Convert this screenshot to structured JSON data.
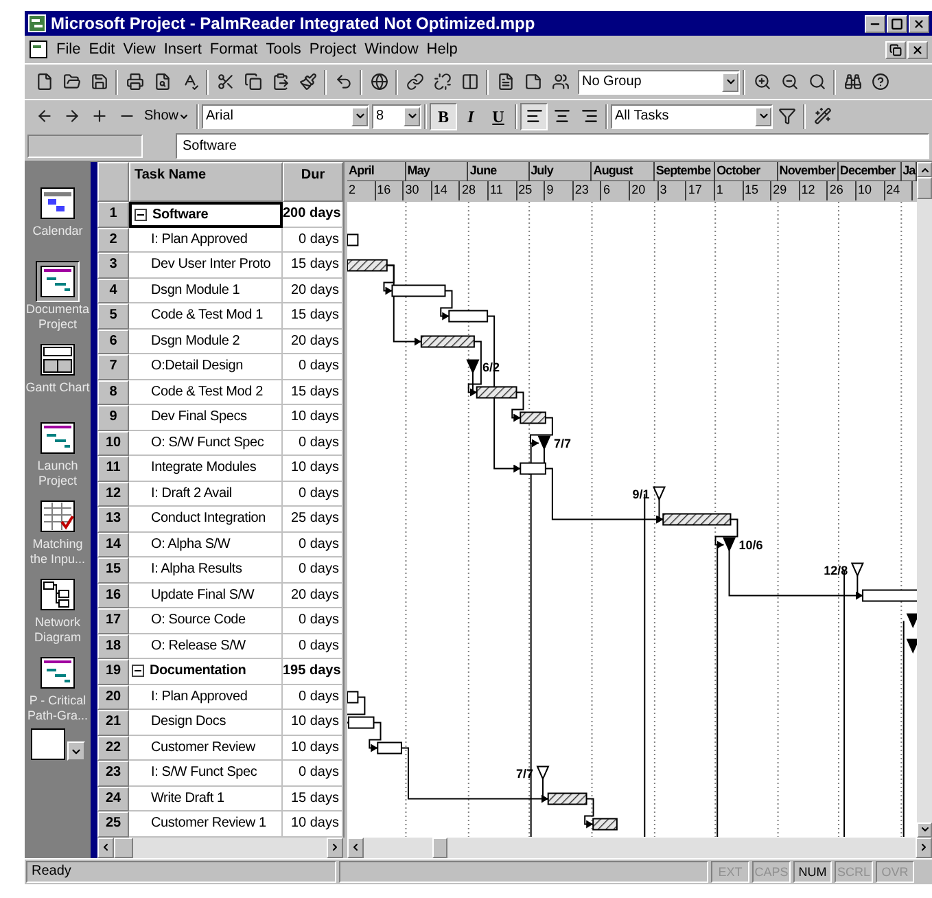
{
  "window": {
    "title": "Microsoft Project - PalmReader Integrated Not Optimized.mpp"
  },
  "menu": [
    "File",
    "Edit",
    "View",
    "Insert",
    "Format",
    "Tools",
    "Project",
    "Window",
    "Help"
  ],
  "standard_toolbar": {
    "group": "No Group"
  },
  "formatting_toolbar": {
    "show": "Show",
    "font": "Arial",
    "size": "8",
    "styles": [
      {
        "label": "B",
        "on": true
      },
      {
        "label": "I",
        "on": false
      },
      {
        "label": "U",
        "on": false
      }
    ],
    "align_buttons": [
      {
        "selected": true
      },
      {
        "selected": false
      },
      {
        "selected": false
      }
    ],
    "filter": "All Tasks"
  },
  "entry_bar": {
    "value": "Software"
  },
  "view_bar": {
    "items": [
      {
        "label": "Calendar",
        "selected": false
      },
      {
        "label": "Documenta Project",
        "selected": true
      },
      {
        "label": "Gantt Chart",
        "selected": false
      },
      {
        "label": "Launch Project",
        "selected": false
      },
      {
        "label": "Matching the Inpu...",
        "selected": false
      },
      {
        "label": "Network Diagram",
        "selected": false
      },
      {
        "label": "P - Critical Path-Gra...",
        "selected": false
      }
    ]
  },
  "table": {
    "columns": [
      "Task Name",
      "Dur"
    ],
    "rows": [
      {
        "id": "1",
        "name": "Software",
        "duration": "200 days",
        "kind": "summary",
        "expanded": true,
        "selected": true
      },
      {
        "id": "2",
        "name": "I: Plan Approved",
        "duration": "0 days",
        "kind": "task",
        "selected": false
      },
      {
        "id": "3",
        "name": "Dev User Inter Proto",
        "duration": "15 days",
        "kind": "task",
        "selected": false
      },
      {
        "id": "4",
        "name": "Dsgn Module 1",
        "duration": "20 days",
        "kind": "task",
        "selected": false
      },
      {
        "id": "5",
        "name": "Code & Test Mod 1",
        "duration": "15 days",
        "kind": "task",
        "selected": false
      },
      {
        "id": "6",
        "name": "Dsgn Module 2",
        "duration": "20 days",
        "kind": "task",
        "selected": false
      },
      {
        "id": "7",
        "name": "O:Detail Design",
        "duration": "0 days",
        "kind": "task",
        "selected": false,
        "gantt_label": "6/2"
      },
      {
        "id": "8",
        "name": "Code & Test Mod 2",
        "duration": "15 days",
        "kind": "task",
        "selected": false
      },
      {
        "id": "9",
        "name": "Dev Final Specs",
        "duration": "10 days",
        "kind": "task",
        "selected": false
      },
      {
        "id": "10",
        "name": "O: S/W Funct Spec",
        "duration": "0 days",
        "kind": "task",
        "selected": false,
        "gantt_label": "7/7"
      },
      {
        "id": "11",
        "name": "Integrate Modules",
        "duration": "10 days",
        "kind": "task",
        "selected": false
      },
      {
        "id": "12",
        "name": "I: Draft 2 Avail",
        "duration": "0 days",
        "kind": "task",
        "selected": false,
        "gantt_label": "9/1"
      },
      {
        "id": "13",
        "name": "Conduct Integration",
        "duration": "25 days",
        "kind": "task",
        "selected": false
      },
      {
        "id": "14",
        "name": "O: Alpha S/W",
        "duration": "0 days",
        "kind": "task",
        "selected": false,
        "gantt_label": "10/6"
      },
      {
        "id": "15",
        "name": "I: Alpha Results",
        "duration": "0 days",
        "kind": "task",
        "selected": false,
        "gantt_label": "12/8"
      },
      {
        "id": "16",
        "name": "Update Final S/W",
        "duration": "20 days",
        "kind": "task",
        "selected": false
      },
      {
        "id": "17",
        "name": "O: Source Code",
        "duration": "0 days",
        "kind": "task",
        "selected": false
      },
      {
        "id": "18",
        "name": "O: Release S/W",
        "duration": "0 days",
        "kind": "task",
        "selected": false
      },
      {
        "id": "19",
        "name": "Documentation",
        "duration": "195 days",
        "kind": "summary",
        "expanded": true,
        "selected": false
      },
      {
        "id": "20",
        "name": "I: Plan Approved",
        "duration": "0 days",
        "kind": "task",
        "selected": false
      },
      {
        "id": "21",
        "name": "Design Docs",
        "duration": "10 days",
        "kind": "task",
        "selected": false
      },
      {
        "id": "22",
        "name": "Customer Review",
        "duration": "10 days",
        "kind": "task",
        "selected": false
      },
      {
        "id": "23",
        "name": "I: S/W Funct Spec",
        "duration": "0 days",
        "kind": "task",
        "selected": false,
        "gantt_label": "7/7"
      },
      {
        "id": "24",
        "name": "Write Draft 1",
        "duration": "15 days",
        "kind": "task",
        "selected": false
      },
      {
        "id": "25",
        "name": "Customer Review 1",
        "duration": "10 days",
        "kind": "task",
        "selected": false
      }
    ]
  },
  "timeline": {
    "months": [
      "April",
      "May",
      "June",
      "July",
      "August",
      "Septembe",
      "October",
      "November",
      "December",
      "Ja"
    ],
    "weeks": [
      "2",
      "16",
      "30",
      "14",
      "28",
      "11",
      "25",
      "9",
      "23",
      "6",
      "20",
      "3",
      "17",
      "1",
      "15",
      "29",
      "12",
      "26",
      "10",
      "24"
    ]
  },
  "status_bar": {
    "text": "Ready",
    "indicators": [
      {
        "label": "EXT",
        "on": false
      },
      {
        "label": "CAPS",
        "on": false
      },
      {
        "label": "NUM",
        "on": true
      },
      {
        "label": "SCRL",
        "on": false
      },
      {
        "label": "OVR",
        "on": false
      }
    ]
  }
}
